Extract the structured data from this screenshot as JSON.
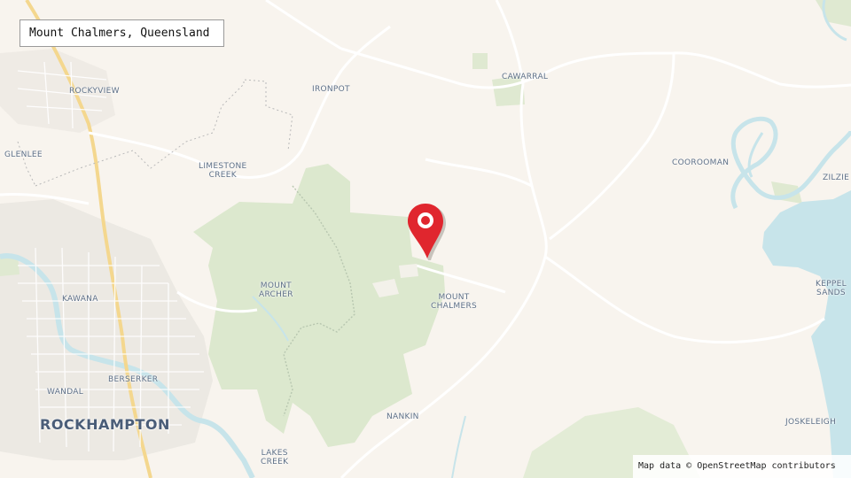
{
  "map": {
    "title": "Mount Chalmers, Queensland",
    "attribution": "Map data © OpenStreetMap contributors",
    "marker_icon": "map-pin-icon",
    "colors": {
      "land": "#f8f4ee",
      "park": "#dde9cf",
      "water": "#c7e4ea",
      "urban": "#ece8e2",
      "road_major": "#f4d78e",
      "road_minor": "#ffffff",
      "marker": "#e0262e"
    },
    "places": {
      "rockyview": "ROCKYVIEW",
      "ironpot": "IRONPOT",
      "cawarral": "CAWARRAL",
      "glenlee": "GLENLEE",
      "limestone_creek": "LIMESTONE\nCREEK",
      "coorooman": "COOROOMAN",
      "zilzie": "ZILZIE",
      "kawana": "KAWANA",
      "mount_archer": "MOUNT\nARCHER",
      "mount_chalmers": "MOUNT\nCHALMERS",
      "keppel_sands": "KEPPEL\nSANDS",
      "berserker": "BERSERKER",
      "wandal": "WANDAL",
      "rockhampton": "ROCKHAMPTON",
      "nankin": "NANKIN",
      "joskeleigh": "JOSKELEIGH",
      "lakes_creek": "LAKES\nCREEK"
    }
  }
}
